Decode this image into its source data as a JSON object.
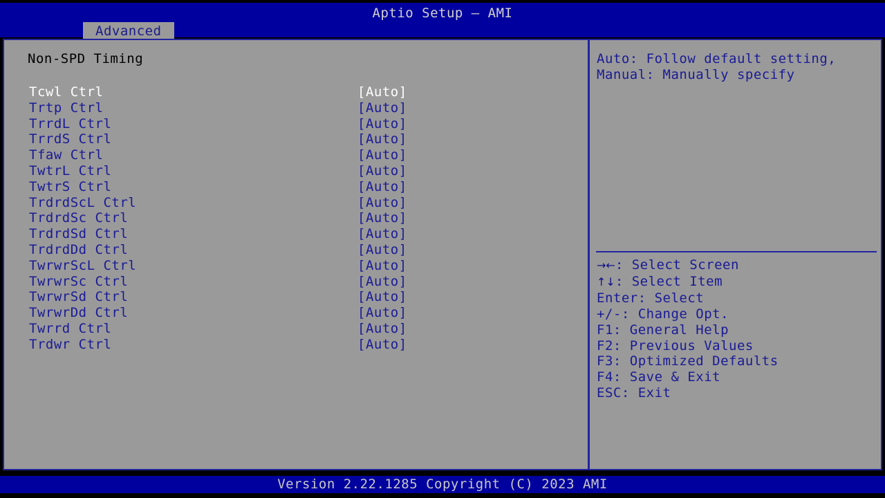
{
  "header": {
    "title": "Aptio Setup – AMI",
    "tabs": [
      {
        "label": "Advanced",
        "active": true
      }
    ]
  },
  "main": {
    "section_title": "Non-SPD Timing",
    "settings": [
      {
        "label": "Tcwl Ctrl",
        "value": "[Auto]",
        "selected": true
      },
      {
        "label": "Trtp Ctrl",
        "value": "[Auto]",
        "selected": false
      },
      {
        "label": "TrrdL Ctrl",
        "value": "[Auto]",
        "selected": false
      },
      {
        "label": "TrrdS Ctrl",
        "value": "[Auto]",
        "selected": false
      },
      {
        "label": "Tfaw Ctrl",
        "value": "[Auto]",
        "selected": false
      },
      {
        "label": "TwtrL Ctrl",
        "value": "[Auto]",
        "selected": false
      },
      {
        "label": "TwtrS Ctrl",
        "value": "[Auto]",
        "selected": false
      },
      {
        "label": "TrdrdScL Ctrl",
        "value": "[Auto]",
        "selected": false
      },
      {
        "label": "TrdrdSc Ctrl",
        "value": "[Auto]",
        "selected": false
      },
      {
        "label": "TrdrdSd Ctrl",
        "value": "[Auto]",
        "selected": false
      },
      {
        "label": "TrdrdDd Ctrl",
        "value": "[Auto]",
        "selected": false
      },
      {
        "label": "TwrwrScL Ctrl",
        "value": "[Auto]",
        "selected": false
      },
      {
        "label": "TwrwrSc Ctrl",
        "value": "[Auto]",
        "selected": false
      },
      {
        "label": "TwrwrSd Ctrl",
        "value": "[Auto]",
        "selected": false
      },
      {
        "label": "TwrwrDd Ctrl",
        "value": "[Auto]",
        "selected": false
      },
      {
        "label": "Twrrd Ctrl",
        "value": "[Auto]",
        "selected": false
      },
      {
        "label": "Trdwr Ctrl",
        "value": "[Auto]",
        "selected": false
      }
    ]
  },
  "help": {
    "description_lines": [
      "Auto: Follow default setting,",
      "Manual: Manually specify"
    ],
    "keys": [
      {
        "glyph": "→←",
        "icon_name": "arrow-right-left-icon",
        "text": ": Select Screen"
      },
      {
        "glyph": "↑↓",
        "icon_name": "arrow-up-down-icon",
        "text": ": Select Item"
      },
      {
        "glyph": "",
        "icon_name": "",
        "text": "Enter: Select"
      },
      {
        "glyph": "",
        "icon_name": "",
        "text": "+/-: Change Opt."
      },
      {
        "glyph": "",
        "icon_name": "",
        "text": "F1: General Help"
      },
      {
        "glyph": "",
        "icon_name": "",
        "text": "F2: Previous Values"
      },
      {
        "glyph": "",
        "icon_name": "",
        "text": "F3: Optimized Defaults"
      },
      {
        "glyph": "",
        "icon_name": "",
        "text": "F4: Save & Exit"
      },
      {
        "glyph": "",
        "icon_name": "",
        "text": "ESC: Exit"
      }
    ]
  },
  "footer": {
    "version_text": "Version 2.22.1285 Copyright (C) 2023 AMI"
  },
  "colors": {
    "header_blue": "#00009e",
    "panel_gray": "#9a9a9a",
    "text_blue": "#1a1a96",
    "border_blue": "#2323a0",
    "selected_white": "#ffffff",
    "section_title_black": "#000000",
    "footer_text": "#c8c8c8"
  }
}
